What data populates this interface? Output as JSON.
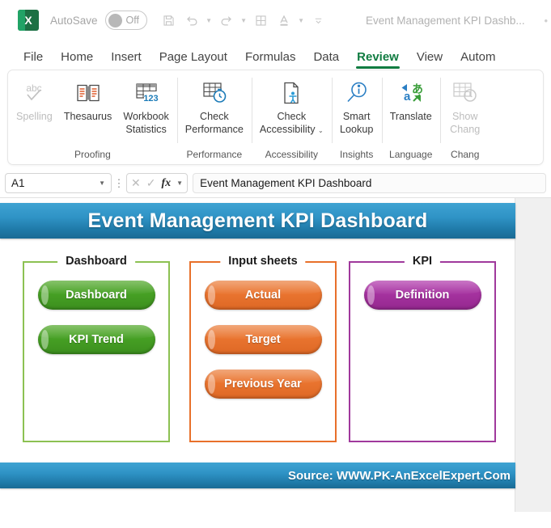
{
  "titlebar": {
    "autosave_label": "AutoSave",
    "autosave_state": "Off",
    "doc_title": "Event Management KPI Dashb...",
    "logo_glyph": "X",
    "quick_access": [
      {
        "name": "save-icon",
        "label": "Save"
      },
      {
        "name": "undo-icon",
        "label": "Undo"
      },
      {
        "name": "redo-icon",
        "label": "Redo"
      },
      {
        "name": "borders-icon",
        "label": "Borders"
      },
      {
        "name": "font-color-icon",
        "label": "Font Color"
      }
    ]
  },
  "tabs": [
    {
      "label": "File",
      "active": false
    },
    {
      "label": "Home",
      "active": false
    },
    {
      "label": "Insert",
      "active": false
    },
    {
      "label": "Page Layout",
      "active": false
    },
    {
      "label": "Formulas",
      "active": false
    },
    {
      "label": "Data",
      "active": false
    },
    {
      "label": "Review",
      "active": true
    },
    {
      "label": "View",
      "active": false
    },
    {
      "label": "Autom",
      "active": false
    }
  ],
  "ribbon": {
    "groups": [
      {
        "label": "Proofing",
        "items": [
          {
            "label": "Spelling",
            "icon": "spelling-abc-check-icon",
            "disabled": true
          },
          {
            "label": "Thesaurus",
            "icon": "thesaurus-book-icon",
            "disabled": false
          },
          {
            "label": "Workbook\nStatistics",
            "icon": "workbook-statistics-icon",
            "disabled": false
          }
        ]
      },
      {
        "label": "Performance",
        "items": [
          {
            "label": "Check\nPerformance",
            "icon": "check-performance-icon",
            "disabled": false
          }
        ]
      },
      {
        "label": "Accessibility",
        "items": [
          {
            "label": "Check\nAccessibility",
            "icon": "check-accessibility-icon",
            "disabled": false,
            "dropdown": true
          }
        ]
      },
      {
        "label": "Insights",
        "items": [
          {
            "label": "Smart\nLookup",
            "icon": "smart-lookup-icon",
            "disabled": false
          }
        ]
      },
      {
        "label": "Language",
        "items": [
          {
            "label": "Translate",
            "icon": "translate-icon",
            "disabled": false
          }
        ]
      },
      {
        "label": "Chang",
        "items": [
          {
            "label": "Show\nChang",
            "icon": "show-changes-icon",
            "disabled": true
          }
        ]
      }
    ]
  },
  "formula_bar": {
    "name_box": "A1",
    "content": "Event Management KPI Dashboard",
    "fx_label": "fx"
  },
  "sheet": {
    "banner_title": "Event Management KPI Dashboard",
    "footer_text": "Source: WWW.PK-AnExcelExpert.Com",
    "panels": [
      {
        "title": "Dashboard",
        "color": "#8cc152",
        "buttons": [
          {
            "label": "Dashboard"
          },
          {
            "label": "KPI Trend"
          }
        ]
      },
      {
        "title": "Input sheets",
        "color": "#e8702a",
        "buttons": [
          {
            "label": "Actual"
          },
          {
            "label": "Target"
          },
          {
            "label": "Previous Year"
          }
        ]
      },
      {
        "title": "KPI",
        "color": "#a0399c",
        "buttons": [
          {
            "label": "Definition"
          }
        ]
      }
    ]
  },
  "colors": {
    "excel_green": "#107c41",
    "banner_blue_top": "#3fa3d2",
    "banner_blue_bottom": "#1a6a94",
    "panel_green": "#8cc152",
    "panel_orange": "#e8702a",
    "panel_purple": "#a0399c",
    "pill_green": "#46a024",
    "pill_orange": "#e9742f",
    "pill_purple": "#a5329f"
  }
}
